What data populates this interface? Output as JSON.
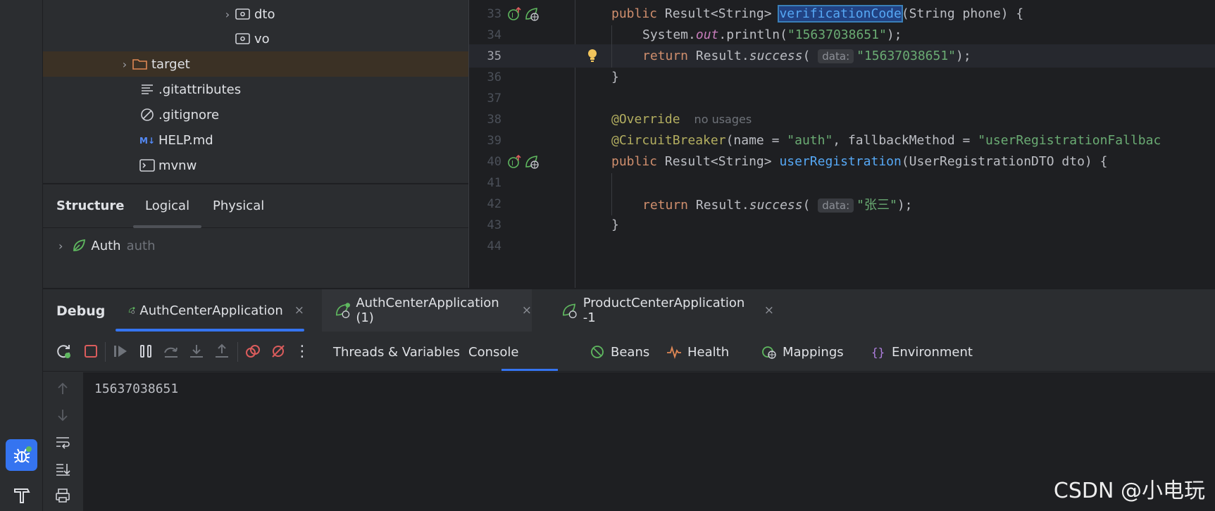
{
  "project_tree": {
    "items": [
      {
        "label": "dto",
        "icon": "package-folder-icon",
        "expand": "›"
      },
      {
        "label": "vo",
        "icon": "package-folder-icon",
        "expand": ""
      },
      {
        "label": "target",
        "icon": "folder-icon",
        "expand": "›"
      },
      {
        "label": ".gitattributes",
        "icon": "text-file-icon",
        "expand": ""
      },
      {
        "label": ".gitignore",
        "icon": "ignore-file-icon",
        "expand": ""
      },
      {
        "label": "HELP.md",
        "icon": "markdown-file-icon",
        "expand": ""
      },
      {
        "label": "mvnw",
        "icon": "shell-script-icon",
        "expand": ""
      }
    ]
  },
  "structure": {
    "title": "Structure",
    "tabs": [
      "Logical",
      "Physical"
    ],
    "node_label": "Auth",
    "node_hint": "auth"
  },
  "editor": {
    "lines": [
      {
        "num": "33"
      },
      {
        "num": "34"
      },
      {
        "num": "35"
      },
      {
        "num": "36"
      },
      {
        "num": "37"
      },
      {
        "num": "38"
      },
      {
        "num": "39"
      },
      {
        "num": "40"
      },
      {
        "num": "41"
      },
      {
        "num": "42"
      },
      {
        "num": "43"
      },
      {
        "num": "44"
      }
    ],
    "tokens": {
      "public": "public",
      "result_type": "Result<String>",
      "method1": "verificationCode",
      "params1": "(String phone) {",
      "system_out": "System.",
      "out": "out",
      "println": ".println(",
      "phone_str": "\"15637038651\"",
      "close_stmt": ");",
      "return": "return",
      "result_success": "Result.",
      "success": "success",
      "open_paren": "(",
      "data_hint": "data:",
      "close_brace": "}",
      "override": "@Override",
      "no_usages": "no usages",
      "circuit": "@CircuitBreaker",
      "circuit_args_1": "(name = ",
      "auth_str": "\"auth\"",
      "circuit_args_2": ", fallbackMethod = ",
      "fallback_str": "\"userRegistrationFallbac",
      "method2": "userRegistration",
      "params2": "(UserRegistrationDTO dto) {",
      "name_str": "\"张三\""
    }
  },
  "debug": {
    "title": "Debug",
    "tabs": [
      {
        "label": "AuthCenterApplication",
        "close": "×"
      },
      {
        "label": "AuthCenterApplication (1)",
        "close": "×"
      },
      {
        "label": "ProductCenterApplication -1",
        "close": "×"
      }
    ],
    "view_tabs": [
      {
        "label": "Threads & Variables",
        "icon": ""
      },
      {
        "label": "Console",
        "icon": ""
      },
      {
        "label": "Beans",
        "icon": "beans-icon"
      },
      {
        "label": "Health",
        "icon": "health-icon"
      },
      {
        "label": "Mappings",
        "icon": "mappings-icon"
      },
      {
        "label": "Environment",
        "icon": "environment-icon"
      }
    ],
    "console_output": "15637038651",
    "more_symbol": "⋮"
  },
  "watermark": "CSDN @小电玩",
  "colors": {
    "accent": "#3574f0",
    "keyword": "#cf8e6d",
    "annotation": "#b3ae60",
    "function": "#56a8f5",
    "string": "#6aab73",
    "stop": "#db5c5c",
    "spring": "#5fb85f"
  }
}
